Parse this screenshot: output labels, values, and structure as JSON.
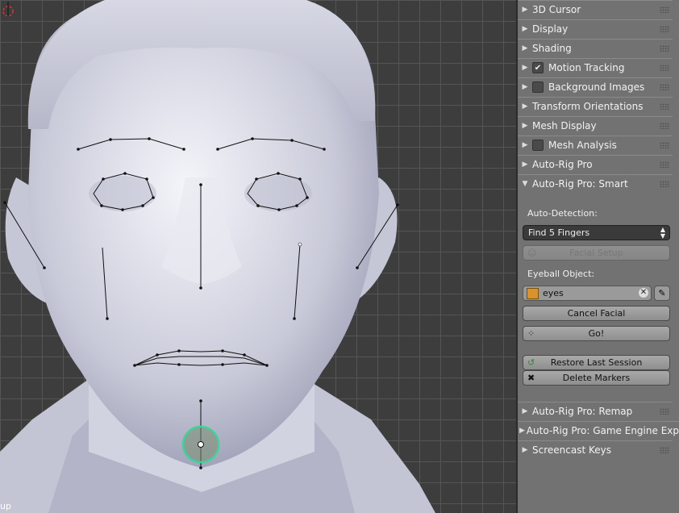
{
  "viewport": {
    "corner_text": "up"
  },
  "panel": {
    "sections_top": [
      {
        "label": "3D Cursor",
        "arrow": "▶",
        "checkbox": false
      },
      {
        "label": "Display",
        "arrow": "▶",
        "checkbox": false
      },
      {
        "label": "Shading",
        "arrow": "▶",
        "checkbox": false
      },
      {
        "label": "Motion Tracking",
        "arrow": "▶",
        "checkbox": true,
        "checked": true
      },
      {
        "label": "Background Images",
        "arrow": "▶",
        "checkbox": true,
        "checked": false
      },
      {
        "label": "Transform Orientations",
        "arrow": "▶",
        "checkbox": false
      },
      {
        "label": "Mesh Display",
        "arrow": "▶",
        "checkbox": false
      },
      {
        "label": "Mesh Analysis",
        "arrow": "▶",
        "checkbox": true,
        "checked": false
      },
      {
        "label": "Auto-Rig Pro",
        "arrow": "▶",
        "checkbox": false
      },
      {
        "label": "Auto-Rig Pro: Smart",
        "arrow": "▼",
        "checkbox": false
      }
    ],
    "smart": {
      "auto_detection_label": "Auto-Detection:",
      "fingers_select": "Find 5 Fingers",
      "facial_setup": "Facial Setup",
      "eyeball_label": "Eyeball Object:",
      "eyeball_value": "eyes",
      "cancel_facial": "Cancel Facial",
      "go": "Go!",
      "restore_session": "Restore Last Session",
      "delete_markers": "Delete Markers"
    },
    "sections_bottom": [
      {
        "label": "Auto-Rig Pro: Remap",
        "arrow": "▶"
      },
      {
        "label": "Auto-Rig Pro: Game Engine Exp",
        "arrow": "▶"
      },
      {
        "label": "Screencast Keys",
        "arrow": "▶"
      }
    ]
  },
  "colors": {
    "panel_bg": "#727272",
    "face": "#dcdde8",
    "marker_green": "#3fd29a"
  }
}
